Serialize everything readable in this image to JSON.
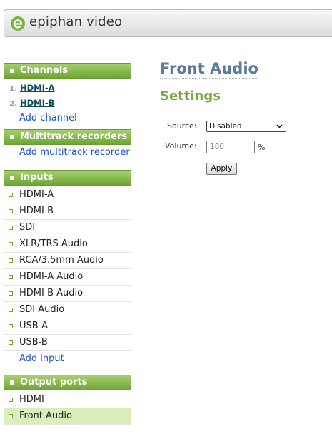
{
  "header": {
    "logo_text": "epiphan video"
  },
  "sidebar": {
    "channels": {
      "title": "Channels",
      "items": [
        {
          "num": "1.",
          "label": "HDMI-A"
        },
        {
          "num": "2.",
          "label": "HDMI-B"
        }
      ],
      "add_label": "Add channel"
    },
    "multitrack": {
      "title": "Multitrack recorders",
      "add_label": "Add multitrack recorder"
    },
    "inputs": {
      "title": "Inputs",
      "items": [
        "HDMI-A",
        "HDMI-B",
        "SDI",
        "XLR/TRS Audio",
        "RCA/3.5mm Audio",
        "HDMI-A Audio",
        "HDMI-B Audio",
        "SDI Audio",
        "USB-A",
        "USB-B"
      ],
      "add_label": "Add input"
    },
    "output_ports": {
      "title": "Output ports",
      "items": [
        "HDMI",
        "Front Audio"
      ],
      "active": "Front Audio"
    }
  },
  "main": {
    "title": "Front Audio",
    "section_title": "Settings",
    "source_label": "Source:",
    "source_value": "Disabled",
    "volume_label": "Volume:",
    "volume_placeholder": "100",
    "volume_unit": "%",
    "apply_label": "Apply"
  },
  "colors": {
    "section_header": "#7cb342",
    "link": "#1a55c0",
    "page_title": "#5d7b9c",
    "settings_title": "#7aa843",
    "active_row": "#dcedb9"
  }
}
